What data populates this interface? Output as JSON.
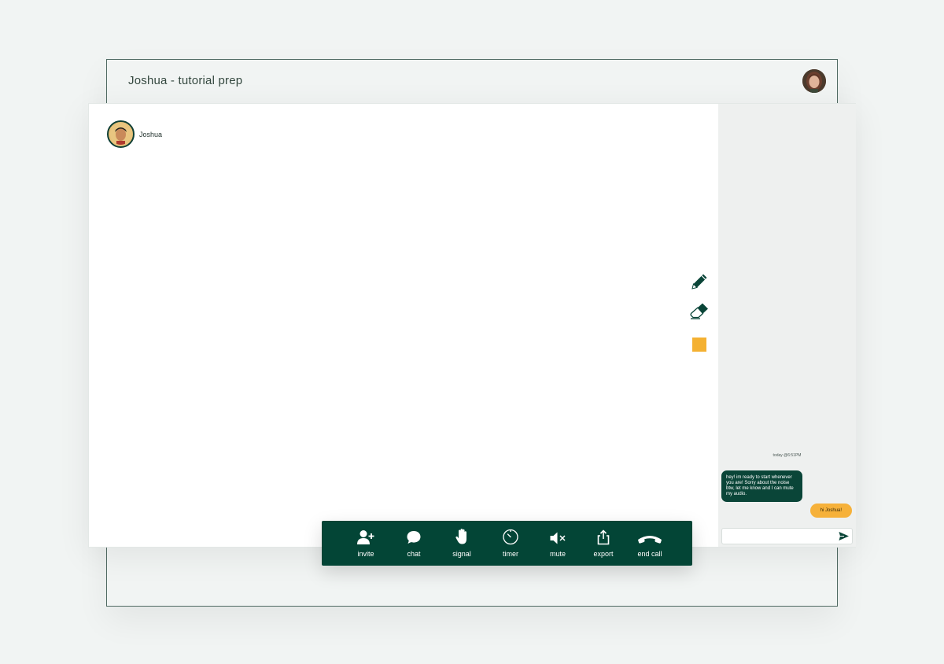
{
  "window": {
    "title": "Joshua - tutorial prep"
  },
  "participant": {
    "name": "Joshua"
  },
  "tools": {
    "pen": "pencil-icon",
    "eraser": "eraser-icon",
    "color": "#f4b132"
  },
  "chat": {
    "timestamp": "today @6:51PM",
    "messages": [
      {
        "from": "remote",
        "text": "hey! im ready to start whenever you are! Sorry about the noise btw, let me know and I can mute my audio."
      },
      {
        "from": "self",
        "text": "hi Joshua!"
      }
    ],
    "input_value": "",
    "input_placeholder": ""
  },
  "toolbar": {
    "invite": "invite",
    "chat": "chat",
    "signal": "signal",
    "timer": "timer",
    "mute": "mute",
    "export": "export",
    "end_call": "end call"
  },
  "colors": {
    "brand": "#034536",
    "accent": "#f6b13a"
  }
}
